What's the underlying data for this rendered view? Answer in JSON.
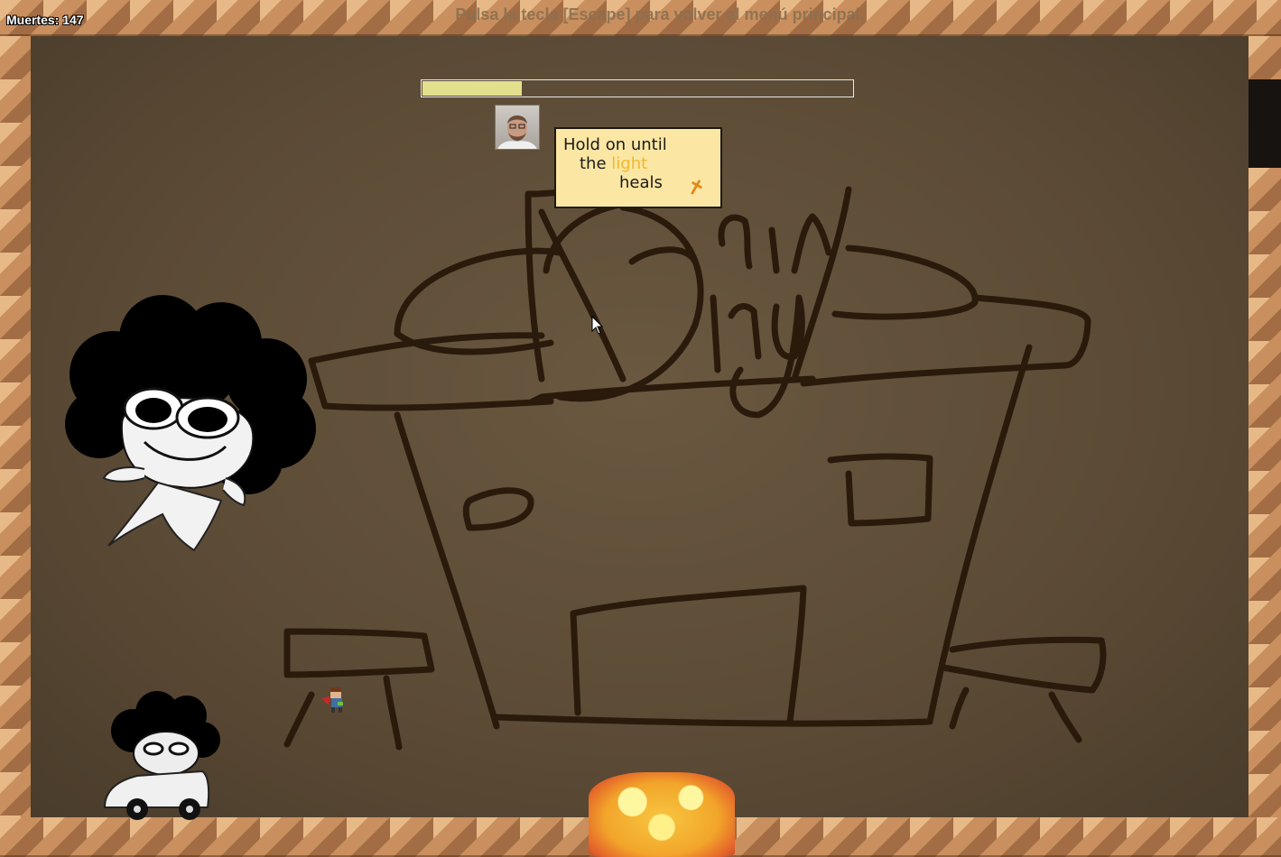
{
  "hud": {
    "deaths_label": "Muertes: 147",
    "escape_hint": "Pulsa la tecla [Escape] para volver al menú principal."
  },
  "boss_progress": 0.235,
  "sign": {
    "line1": "Hold on until",
    "line2_pre": "the",
    "line2_highlight": "light",
    "line3": "heals"
  },
  "sprites": {
    "player": "player-sprite",
    "boss_large": "afro-boss-figure",
    "boss_car": "afro-boss-in-car",
    "hazard": "fire-explosion",
    "webcam": "streamer-webcam"
  },
  "colors": {
    "brick": "#c98f5e",
    "background": "#5e4d38",
    "progress_fill": "#e3e08e",
    "sign_paper": "#fbe7a3",
    "sign_highlight": "#f2b632"
  }
}
